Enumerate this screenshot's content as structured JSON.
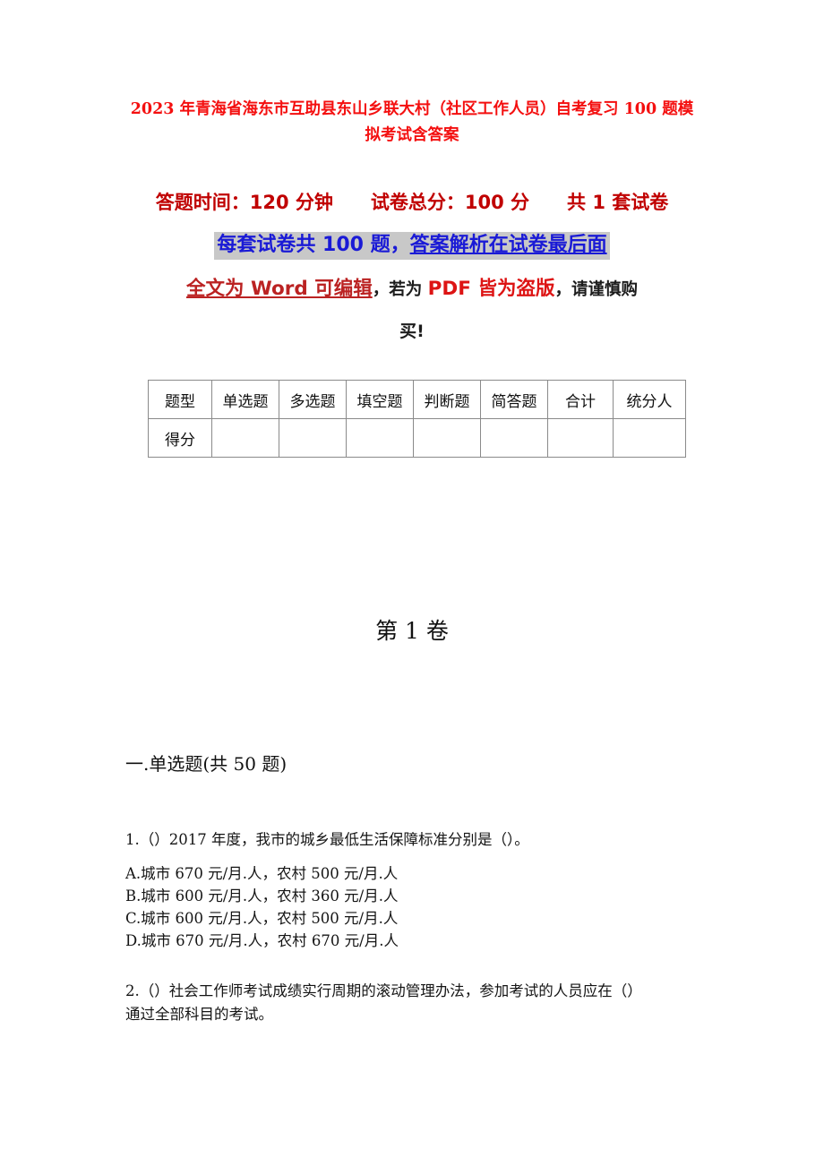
{
  "document": {
    "title": "2023 年青海省海东市互助县东山乡联大村（社区工作人员）自考复习 100 题模拟考试含答案",
    "info": {
      "line1": "答题时间：120 分钟　　试卷总分：100 分　　共 1 套试卷",
      "line2_prefix": "每套试卷共 100 题，",
      "line2_underlined": "答案解析在试卷最后面",
      "line3_word": "全文为 Word 可编辑",
      "line3_mid": "，若为 ",
      "line3_pdf": "PDF 皆为盗版",
      "line3_tail": "，请谨慎购",
      "line4": "买!"
    },
    "score_table": {
      "headers": [
        "题型",
        "单选题",
        "多选题",
        "填空题",
        "判断题",
        "简答题",
        "合计",
        "统分人"
      ],
      "row_label": "得分",
      "row_values": [
        "",
        "",
        "",
        "",
        "",
        "",
        ""
      ]
    },
    "volume_heading": "第 1 卷",
    "section_heading": "一.单选题(共 50 题)",
    "questions": [
      {
        "number": "1.",
        "text": "1.（）2017 年度，我市的城乡最低生活保障标准分别是（）。",
        "options": [
          "A.城市 670 元/月.人，农村 500 元/月.人",
          "B.城市 600 元/月.人，农村 360 元/月.人",
          "C.城市 600 元/月.人，农村 500 元/月.人",
          "D.城市 670 元/月.人，农村 670 元/月.人"
        ]
      },
      {
        "number": "2.",
        "text": "2.（）社会工作师考试成绩实行周期的滚动管理办法，参加考试的人员应在（）\n通过全部科目的考试。",
        "options": []
      }
    ],
    "colors": {
      "title_red": "#f40f0f",
      "info_red": "#c00000",
      "highlight_bg": "#c8c8c8",
      "highlight_blue": "#1a1ad6",
      "word_red": "#bb2222",
      "pdf_red": "#dd1414",
      "body_text": "#141414",
      "table_border": "#8a8a8a"
    }
  }
}
